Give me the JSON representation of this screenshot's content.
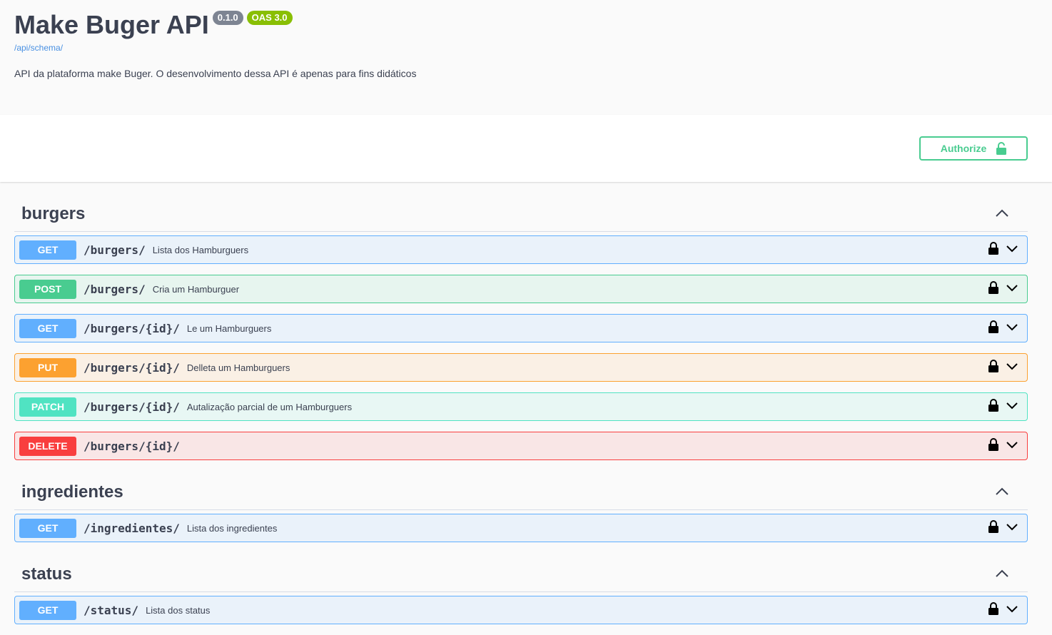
{
  "info": {
    "title": "Make Buger API",
    "version": "0.1.0",
    "oas": "OAS 3.0",
    "schema_url": "/api/schema/",
    "description": "API da plataforma make Buger. O desenvolvimento dessa API é apenas para fins didáticos"
  },
  "authorize": {
    "label": "Authorize",
    "icon": "unlock-icon"
  },
  "colors": {
    "get": "#61affe",
    "post": "#49cc90",
    "put": "#fca130",
    "patch": "#50e3c2",
    "delete": "#f93e3e"
  },
  "tags": [
    {
      "name": "burgers",
      "operations": [
        {
          "method": "GET",
          "path": "/burgers/",
          "summary": "Lista dos Hamburguers"
        },
        {
          "method": "POST",
          "path": "/burgers/",
          "summary": "Cria um Hamburguer"
        },
        {
          "method": "GET",
          "path": "/burgers/{id}/",
          "summary": "Le um Hamburguers"
        },
        {
          "method": "PUT",
          "path": "/burgers/{id}/",
          "summary": "Delleta um Hamburguers"
        },
        {
          "method": "PATCH",
          "path": "/burgers/{id}/",
          "summary": "Autalização parcial de um Hamburguers"
        },
        {
          "method": "DELETE",
          "path": "/burgers/{id}/",
          "summary": ""
        }
      ]
    },
    {
      "name": "ingredientes",
      "operations": [
        {
          "method": "GET",
          "path": "/ingredientes/",
          "summary": "Lista dos ingredientes"
        }
      ]
    },
    {
      "name": "status",
      "operations": [
        {
          "method": "GET",
          "path": "/status/",
          "summary": "Lista dos status"
        }
      ]
    }
  ]
}
